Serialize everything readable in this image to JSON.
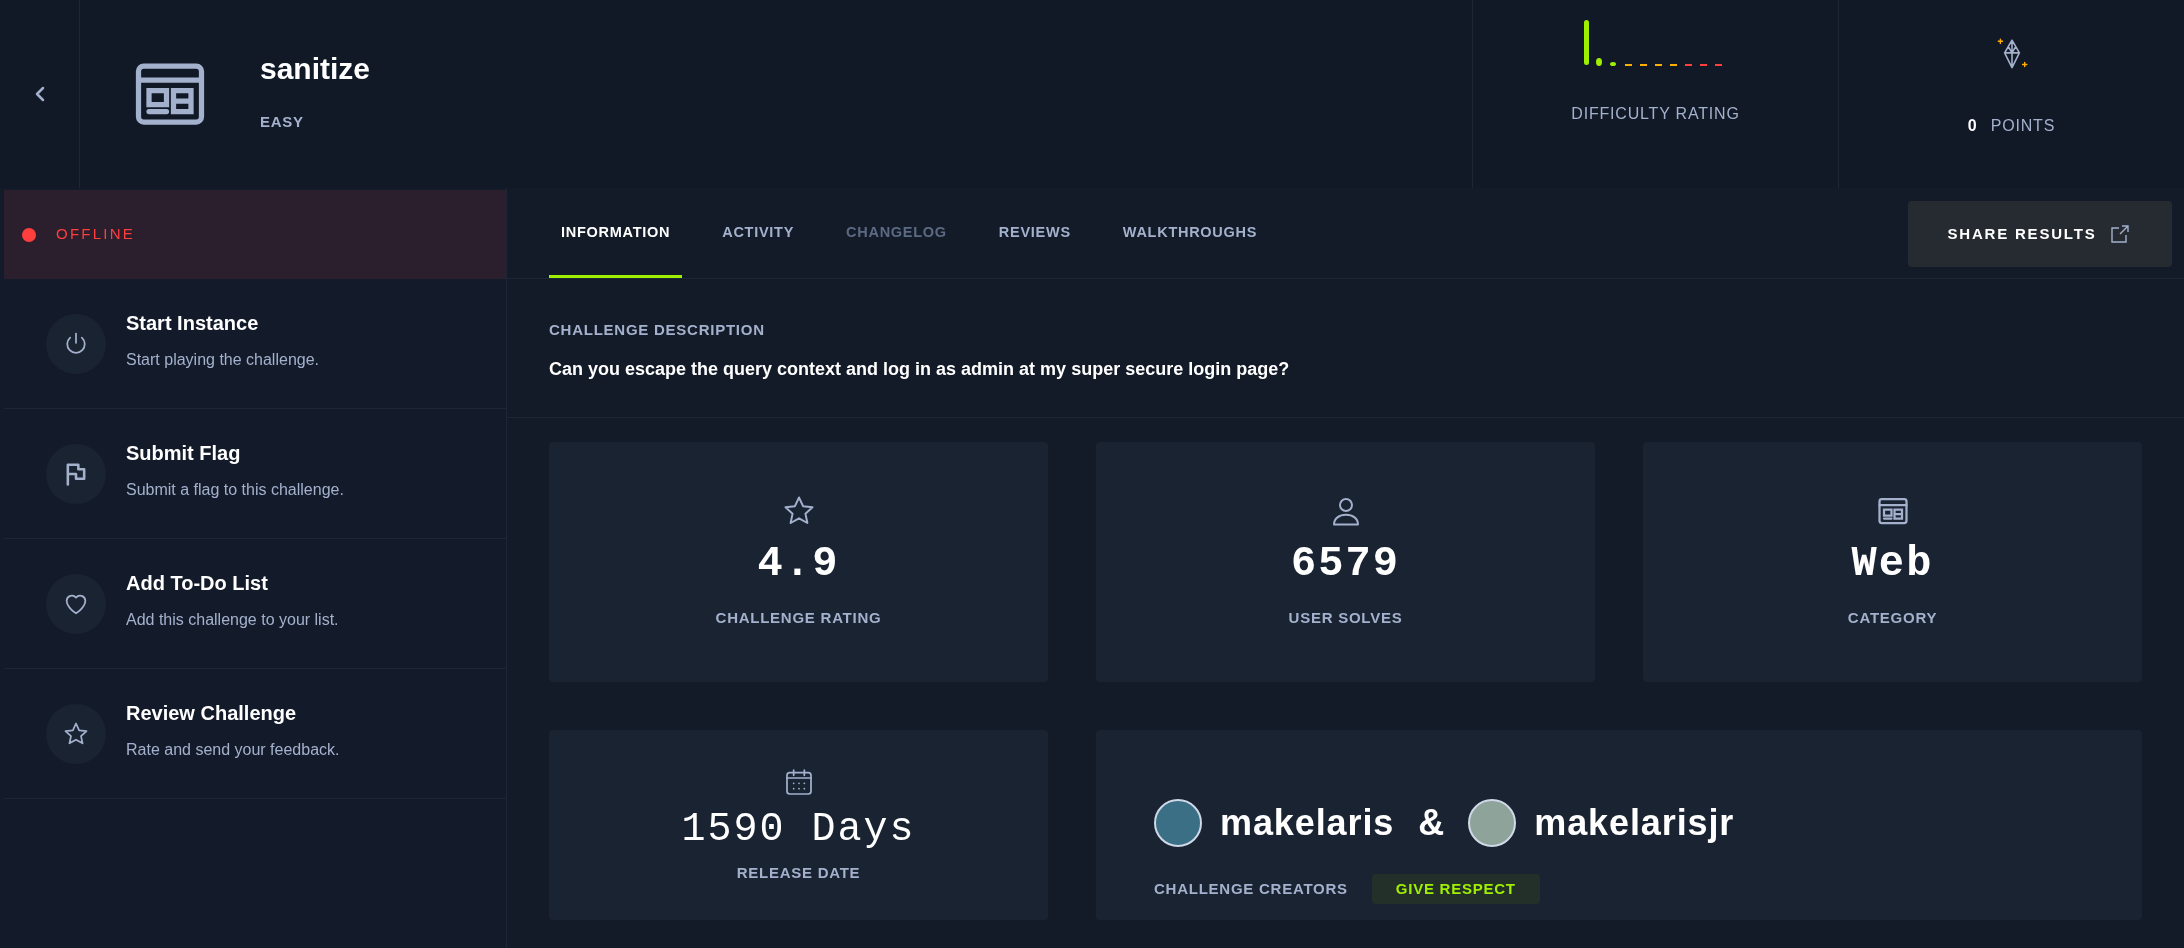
{
  "header": {
    "title": "sanitize",
    "difficulty": "EASY",
    "difficulty_label": "DIFFICULTY RATING",
    "points_value": "0",
    "points_label": "POINTS"
  },
  "status": {
    "label": "OFFLINE",
    "online": false
  },
  "actions": [
    {
      "kind": "power",
      "title": "Start Instance",
      "description": "Start playing the challenge."
    },
    {
      "kind": "flag",
      "title": "Submit Flag",
      "description": "Submit a flag to this challenge."
    },
    {
      "kind": "heart",
      "title": "Add To-Do List",
      "description": "Add this challenge to your list."
    },
    {
      "kind": "star",
      "title": "Review Challenge",
      "description": "Rate and send your feedback."
    }
  ],
  "tabs": [
    {
      "label": "INFORMATION",
      "selected": true,
      "disabled": false
    },
    {
      "label": "ACTIVITY",
      "selected": false,
      "disabled": false
    },
    {
      "label": "CHANGELOG",
      "selected": false,
      "disabled": true
    },
    {
      "label": "REVIEWS",
      "selected": false,
      "disabled": false
    },
    {
      "label": "WALKTHROUGHS",
      "selected": false,
      "disabled": false
    }
  ],
  "share_button": {
    "label": "SHARE RESULTS"
  },
  "description": {
    "heading": "CHALLENGE DESCRIPTION",
    "text": "Can you escape the query context and log in as admin at my super secure login page?"
  },
  "stats": [
    {
      "kind": "star",
      "value": "4.9",
      "label": "CHALLENGE RATING"
    },
    {
      "kind": "user",
      "value": "6579",
      "label": "USER SOLVES"
    },
    {
      "kind": "web",
      "value": "Web",
      "label": "CATEGORY"
    }
  ],
  "release": {
    "value": "1590 Days",
    "label": "RELEASE DATE"
  },
  "creators": {
    "names": [
      "makelaris",
      "makelarisjr"
    ],
    "separator": "&",
    "label": "CHALLENGE CREATORS",
    "respect_button": "GIVE RESPECT"
  }
}
